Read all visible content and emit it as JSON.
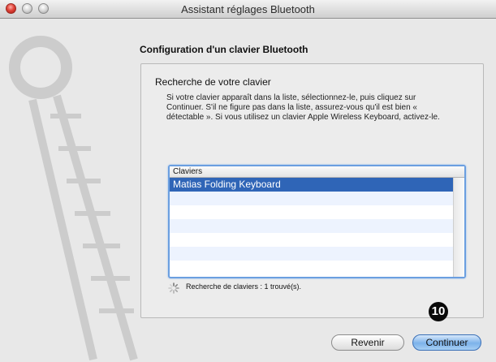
{
  "window": {
    "title": "Assistant réglages Bluetooth"
  },
  "page": {
    "heading": "Configuration d'un clavier Bluetooth",
    "subheading": "Recherche de votre clavier",
    "description": "Si votre clavier apparaît dans la liste, sélectionnez-le, puis cliquez sur Continuer. S'il ne figure pas dans la liste, assurez-vous qu'il est bien « détectable ». Si vous utilisez un clavier Apple Wireless Keyboard, activez-le."
  },
  "keyboard_list": {
    "column_header": "Claviers",
    "items": [
      "Matias Folding Keyboard"
    ],
    "selected_index": 0
  },
  "status": {
    "text": "Recherche de claviers : 1 trouvé(s)."
  },
  "callout": {
    "number": "10"
  },
  "buttons": {
    "back_label": "Revenir",
    "continue_label": "Continuer"
  },
  "colors": {
    "selection": "#2f65b7",
    "focus_ring": "#6b9fe0",
    "default_button": "#7cb2ea"
  }
}
